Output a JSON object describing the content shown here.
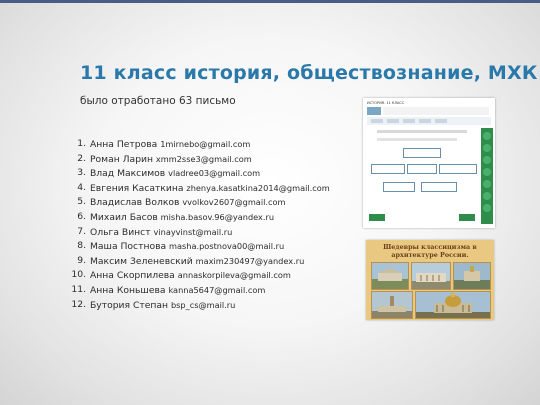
{
  "title": "11 класс история, обществознание, МХК",
  "subtitle": "было отработано 63 письмо",
  "students": [
    {
      "num": "1.",
      "name": "Анна Петрова ",
      "email": "1mirnebo@gmail.com"
    },
    {
      "num": "2.",
      "name": "Роман Ларин ",
      "email": "xmm2sse3@gmail.com"
    },
    {
      "num": "3.",
      "name": "Влад Максимов ",
      "email": "vladree03@gmail.com"
    },
    {
      "num": "4.",
      "name": "Евгения Касаткина ",
      "email": "zhenya.kasatkina2014@gmail.com"
    },
    {
      "num": "5.",
      "name": "Владислав Волков ",
      "email": "vvolkov2607@gmail.com"
    },
    {
      "num": "6.",
      "name": "Михаил Басов ",
      "email": "misha.basov.96@yandex.ru"
    },
    {
      "num": "7.",
      "name": "Ольга Винст ",
      "email": "vinayvinst@mail.ru"
    },
    {
      "num": "8.",
      "name": "Маша Постнова ",
      "email": "masha.postnova00@mail.ru"
    },
    {
      "num": "9.",
      "name": "Максим Зеленевский ",
      "email": "maxim230497@yandex.ru"
    },
    {
      "num": "10.",
      "name": "Анна Скорпилева ",
      "email": "annaskorpileva@gmail.com"
    },
    {
      "num": "11.",
      "name": "Анна Коньшева ",
      "email": "kanna5647@gmail.com"
    },
    {
      "num": "12.",
      "name": "Бутория Степан ",
      "email": "bsp_cs@mail.ru"
    }
  ],
  "screenshot_header": "ИСТОРИЯ. 11 КЛАСС",
  "painting_caption": "Шедевры классицизма в архитектуре России.",
  "colors": {
    "title": "#2a79aa",
    "accent": "#4a5b85",
    "green": "#2f8c4a"
  }
}
